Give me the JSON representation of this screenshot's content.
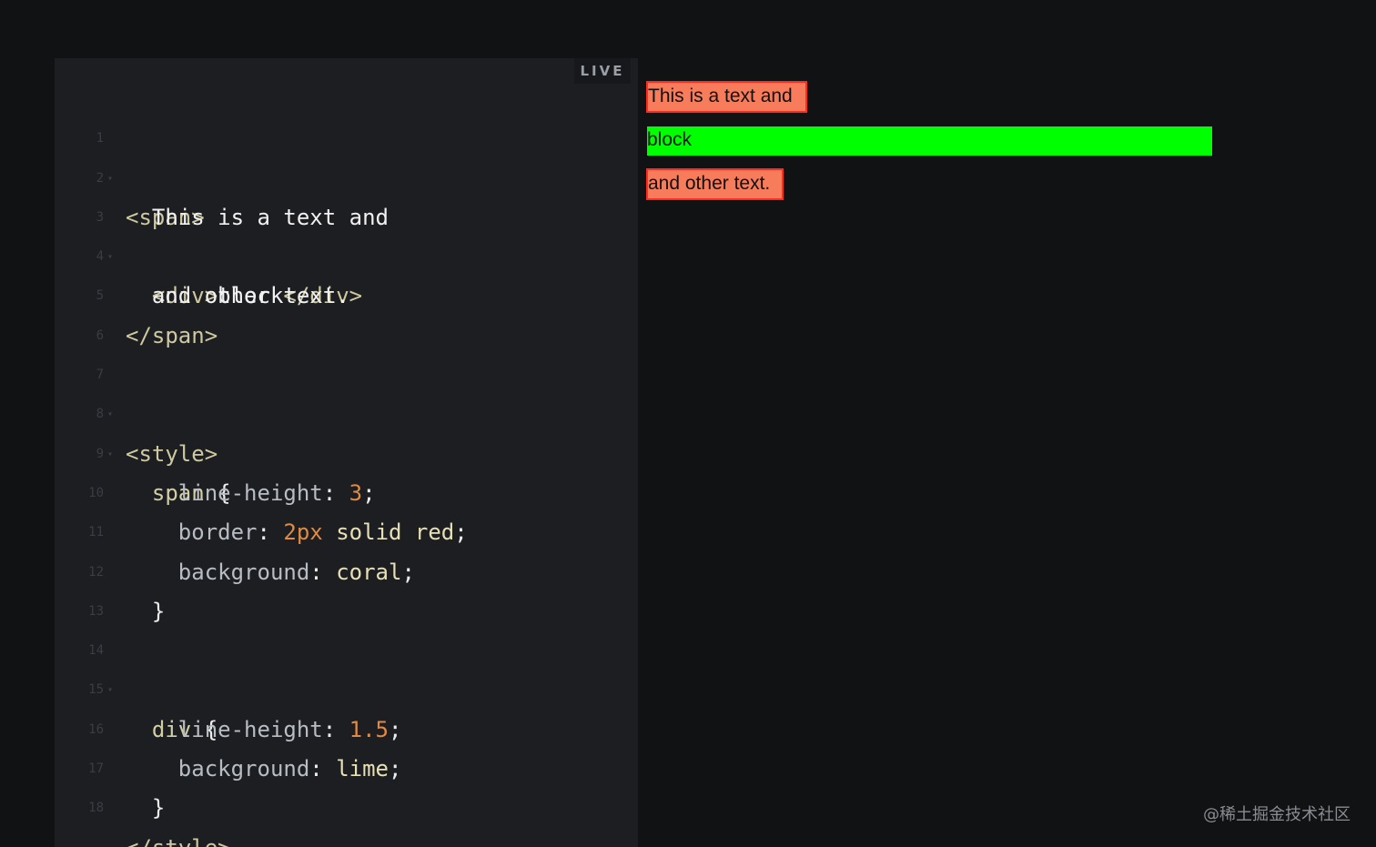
{
  "editor": {
    "badge": "LIVE",
    "lines": [
      {
        "n": "1",
        "fold": true
      },
      {
        "n": "2",
        "fold": false
      },
      {
        "n": "3",
        "fold": true
      },
      {
        "n": "4",
        "fold": false
      },
      {
        "n": "5",
        "fold": false
      },
      {
        "n": "6",
        "fold": false
      },
      {
        "n": "7",
        "fold": true
      },
      {
        "n": "8",
        "fold": true
      },
      {
        "n": "9",
        "fold": false
      },
      {
        "n": "10",
        "fold": false
      },
      {
        "n": "11",
        "fold": false
      },
      {
        "n": "12",
        "fold": false
      },
      {
        "n": "13",
        "fold": false
      },
      {
        "n": "14",
        "fold": true
      },
      {
        "n": "15",
        "fold": false
      },
      {
        "n": "16",
        "fold": false
      },
      {
        "n": "17",
        "fold": false
      },
      {
        "n": "18",
        "fold": false
      }
    ],
    "code": {
      "l1_open_span": "<span>",
      "l2_text": "This is a text and",
      "l3_open_div": "<div>",
      "l3_block": "block",
      "l3_close_div": "</div>",
      "l4_text": "and other text.",
      "l5_close_span": "</span>",
      "l7_open_style": "<style>",
      "l8_selector": "span",
      "l8_brace": " {",
      "l9_prop": "line-height",
      "l9_colon": ": ",
      "l9_value": "3",
      "l9_semi": ";",
      "l10_prop": "border",
      "l10_colon": ": ",
      "l10_num": "2px",
      "l10_rest": " solid red",
      "l10_semi": ";",
      "l11_prop": "background",
      "l11_colon": ": ",
      "l11_value": "coral",
      "l11_semi": ";",
      "l12_close": "}",
      "l14_selector": "div",
      "l14_brace": " {",
      "l15_prop": "line-height",
      "l15_colon": ": ",
      "l15_value": "1.5",
      "l15_semi": ";",
      "l16_prop": "background",
      "l16_colon": ": ",
      "l16_value": "lime",
      "l16_semi": ";",
      "l17_close": "}",
      "l18_close_style": "</style>"
    }
  },
  "preview": {
    "span_text_1": "This is a text and",
    "div_text": "block",
    "span_text_2": "and other text."
  },
  "watermark": "@稀土掘金技术社区",
  "colors": {
    "background": "#111214",
    "editor_bg": "#1c1e22",
    "coral": "#f67c5c",
    "red": "#ff2b1f",
    "lime": "#00ff00",
    "number": "#e08a42"
  }
}
